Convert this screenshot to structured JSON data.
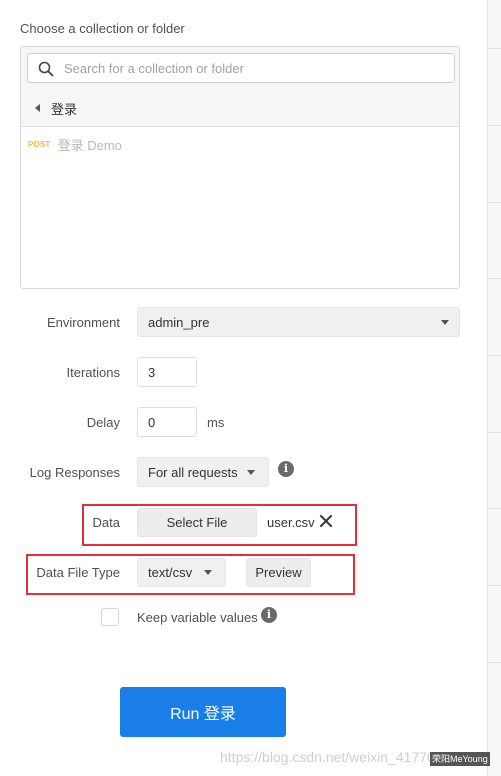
{
  "picker": {
    "heading": "Choose a collection or folder",
    "search_placeholder": "Search for a collection or folder",
    "breadcrumb": "登录",
    "requests": [
      {
        "method": "POST",
        "name": "登录 Demo"
      }
    ]
  },
  "form": {
    "environment": {
      "label": "Environment",
      "value": "admin_pre"
    },
    "iterations": {
      "label": "Iterations",
      "value": "3"
    },
    "delay": {
      "label": "Delay",
      "value": "0",
      "unit": "ms"
    },
    "log_responses": {
      "label": "Log Responses",
      "value": "For all requests"
    },
    "data": {
      "label": "Data",
      "button": "Select File",
      "file": "user.csv"
    },
    "data_file_type": {
      "label": "Data File Type",
      "value": "text/csv",
      "preview_button": "Preview"
    },
    "keep_variable_values": {
      "label": "Keep variable values",
      "checked": false
    }
  },
  "run_button": "Run 登录",
  "watermark": "https://blog.csdn.net/weixin_41770600",
  "badge": "荣阳MeYoung",
  "colors": {
    "primary": "#1a7ee8",
    "highlight_box": "#e0303a",
    "post_method": "#f5b942"
  }
}
